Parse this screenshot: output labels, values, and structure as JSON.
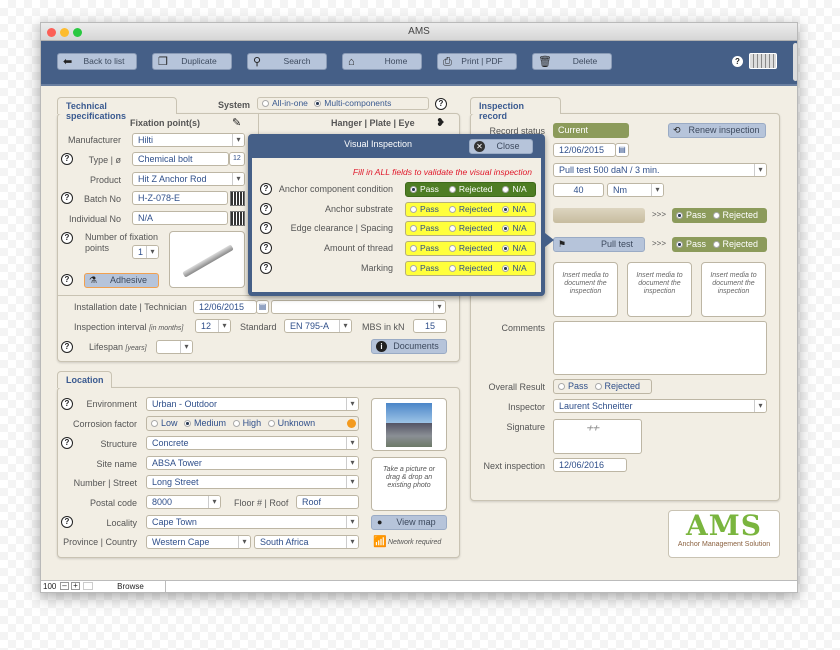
{
  "window": {
    "title": "AMS"
  },
  "toolbar": {
    "back": "Back to list",
    "duplicate": "Duplicate",
    "search": "Search",
    "home": "Home",
    "print": "Print | PDF",
    "delete": "Delete",
    "help": "?"
  },
  "tech": {
    "tab": "Technical specifications",
    "system_label": "System",
    "system_options": [
      "All-in-one",
      "Multi-components"
    ],
    "system_selected": "Multi-components",
    "fixation_header": "Fixation point(s)",
    "hanger_header": "Hanger | Plate | Eye",
    "manufacturer_label": "Manufacturer",
    "manufacturer": "Hilti",
    "type_label": "Type | ø",
    "type": "Chemical bolt",
    "diameter": "12",
    "product_label": "Product",
    "product": "Hit Z Anchor Rod",
    "batch_label": "Batch No",
    "batch": "H-Z-078-E",
    "individual_label": "Individual No",
    "individual": "N/A",
    "fixation_count_label": "Number of fixation points",
    "fixation_count": "1",
    "adhesive": "Adhesive",
    "install_label": "Installation date | Technician",
    "install_date": "12/06/2015",
    "technician": "",
    "interval_label": "Inspection interval",
    "interval_unit": "[in months]",
    "interval": "12",
    "standard_label": "Standard",
    "standard": "EN 795-A",
    "mbs_label": "MBS in kN",
    "mbs": "15",
    "lifespan_label": "Lifespan",
    "lifespan_unit": "[years]",
    "lifespan": "",
    "documents": "Documents"
  },
  "modal": {
    "title": "Visual Inspection",
    "close": "Close",
    "warning": "Fill in ALL fields to validate the visual inspection",
    "options": [
      "Pass",
      "Rejected",
      "N/A"
    ],
    "rows": [
      {
        "label": "Anchor component condition",
        "selected": "Pass"
      },
      {
        "label": "Anchor substrate",
        "selected": "N/A"
      },
      {
        "label": "Edge clearance | Spacing",
        "selected": "N/A"
      },
      {
        "label": "Amount of thread",
        "selected": "N/A"
      },
      {
        "label": "Marking",
        "selected": "N/A"
      }
    ]
  },
  "location": {
    "tab": "Location",
    "environment_label": "Environment",
    "environment": "Urban - Outdoor",
    "corrosion_label": "Corrosion factor",
    "corrosion_options": [
      "Low",
      "Medium",
      "High",
      "Unknown"
    ],
    "corrosion_selected": "Medium",
    "corrosion_color": "#f39a1e",
    "structure_label": "Structure",
    "structure": "Concrete",
    "site_label": "Site name",
    "site": "ABSA Tower",
    "street_label": "Number | Street",
    "street": "Long Street",
    "postal_label": "Postal code",
    "postal": "8000",
    "floor_label": "Floor # | Roof",
    "floor": "Roof",
    "locality_label": "Locality",
    "locality": "Cape Town",
    "province_label": "Province | Country",
    "province": "Western Cape",
    "country": "South Africa",
    "photo_hint": "Take a picture or drag & drop an existing photo",
    "view_map": "View map",
    "network": "Network required"
  },
  "record": {
    "tab": "Inspection record",
    "status_label": "Record status",
    "status": "Current",
    "renew": "Renew inspection",
    "date": "12/06/2015",
    "test": "Pull test 500 daN / 3 min.",
    "torque": "40",
    "torque_unit": "Nm",
    "arrows": ">>>",
    "pass": "Pass",
    "rejected": "Rejected",
    "pull_test": "Pull test",
    "media_hint": "Insert media to document the inspection",
    "comments_label": "Comments",
    "comments": "",
    "overall_label": "Overall Result",
    "inspector_label": "Inspector",
    "inspector": "Laurent Schneitter",
    "signature_label": "Signature",
    "next_label": "Next inspection",
    "next": "12/06/2016"
  },
  "logo": {
    "text": "AMS",
    "subtitle": "Anchor Management Solution"
  },
  "statusbar": {
    "zoom": "100",
    "mode": "Browse"
  }
}
